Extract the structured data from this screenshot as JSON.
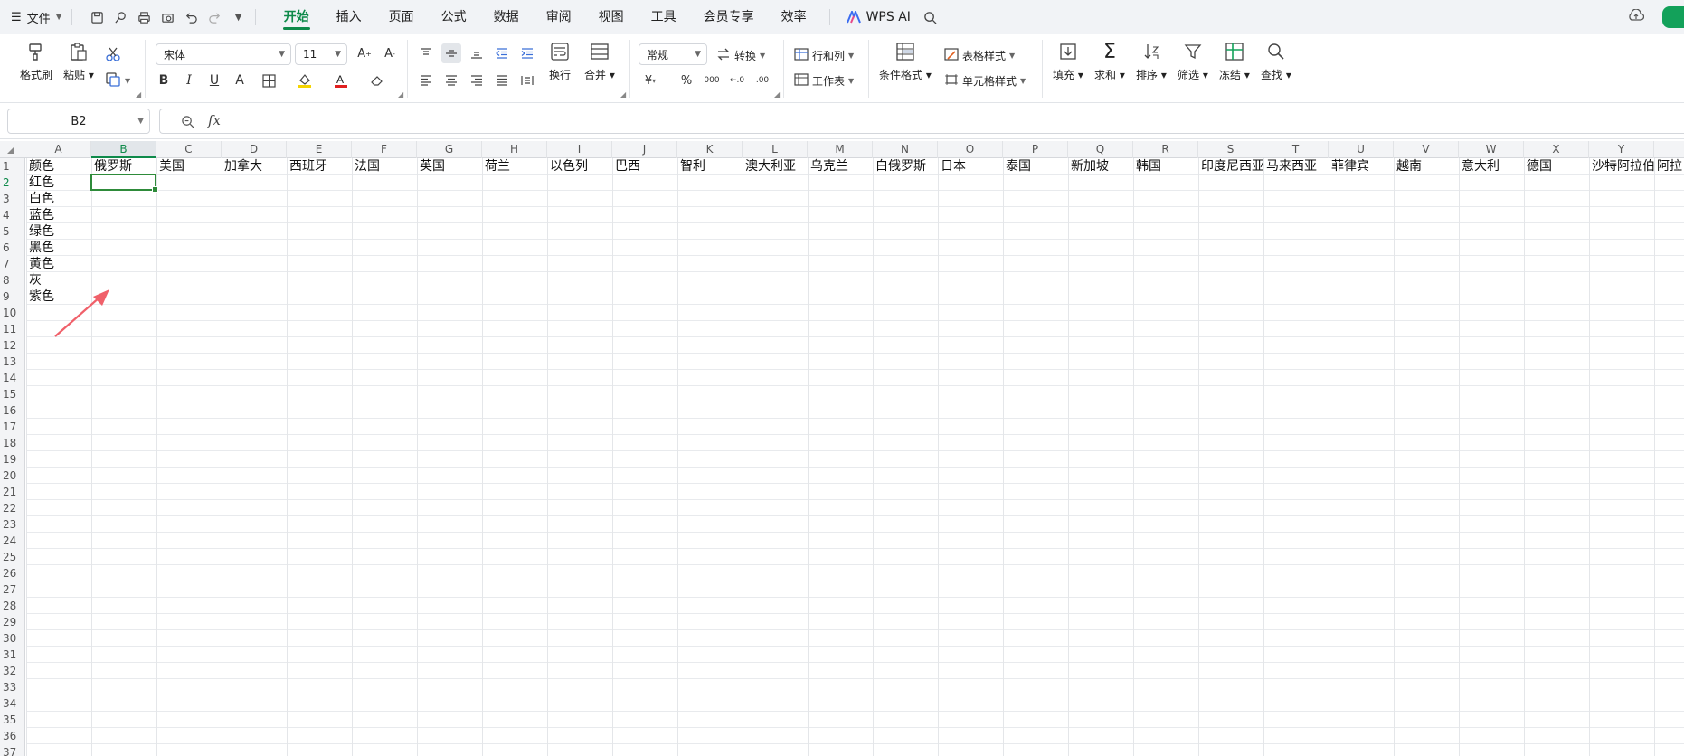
{
  "menubar": {
    "file_label": "文件",
    "tabs": [
      "开始",
      "插入",
      "页面",
      "公式",
      "数据",
      "审阅",
      "视图",
      "工具",
      "会员专享",
      "效率"
    ],
    "active_tab": "开始",
    "wps_ai_label": "WPS AI"
  },
  "ribbon": {
    "format_painter": "格式刷",
    "paste": "粘贴",
    "font_name": "宋体",
    "font_size": "11",
    "wrap": "换行",
    "merge": "合并",
    "number_format": "常规",
    "convert": "转换",
    "rows_cols": "行和列",
    "worksheet": "工作表",
    "cond_format": "条件格式",
    "table_style": "表格样式",
    "cell_style": "单元格样式",
    "fill": "填充",
    "sum": "求和",
    "sort": "排序",
    "filter": "筛选",
    "freeze": "冻结",
    "find": "查找",
    "bold": "B",
    "italic": "I",
    "underline": "U",
    "strike": "A",
    "percent": "%",
    "currency": "¥"
  },
  "formula_bar": {
    "cell_ref": "B2",
    "fx_label": "fx",
    "content": ""
  },
  "sheet": {
    "columns": [
      "A",
      "B",
      "C",
      "D",
      "E",
      "F",
      "G",
      "H",
      "I",
      "J",
      "K",
      "L",
      "M",
      "N",
      "O",
      "P",
      "Q",
      "R",
      "S",
      "T",
      "U",
      "V",
      "W",
      "X",
      "Y"
    ],
    "selected_column": "B",
    "selected_row": 2,
    "rows_visible": [
      "1",
      "2",
      "3",
      "4",
      "5",
      "6",
      "7",
      "8",
      "9",
      "10",
      "11",
      "12",
      "13",
      "14",
      "15",
      "16",
      "17",
      "18",
      "19",
      "20",
      "21",
      "22",
      "23",
      "24",
      "25",
      "26",
      "27",
      "28",
      "29",
      "30",
      "31",
      "32",
      "33",
      "34",
      "35",
      "36",
      "37"
    ],
    "header_row": [
      "颜色",
      "俄罗斯",
      "美国",
      "加拿大",
      "西班牙",
      "法国",
      "英国",
      "荷兰",
      "以色列",
      "巴西",
      "智利",
      "澳大利亚",
      "乌克兰",
      "白俄罗斯",
      "日本",
      "泰国",
      "新加坡",
      "韩国",
      "印度尼西亚",
      "马来西亚",
      "菲律宾",
      "越南",
      "意大利",
      "德国",
      "沙特阿拉伯",
      "阿拉"
    ],
    "column_a_values": [
      "红色",
      "白色",
      "蓝色",
      "绿色",
      "黑色",
      "黄色",
      "灰",
      "紫色"
    ]
  },
  "colors": {
    "accent": "#0e8a4a",
    "selection": "#2e8b3a",
    "arrow": "#f0606a"
  }
}
